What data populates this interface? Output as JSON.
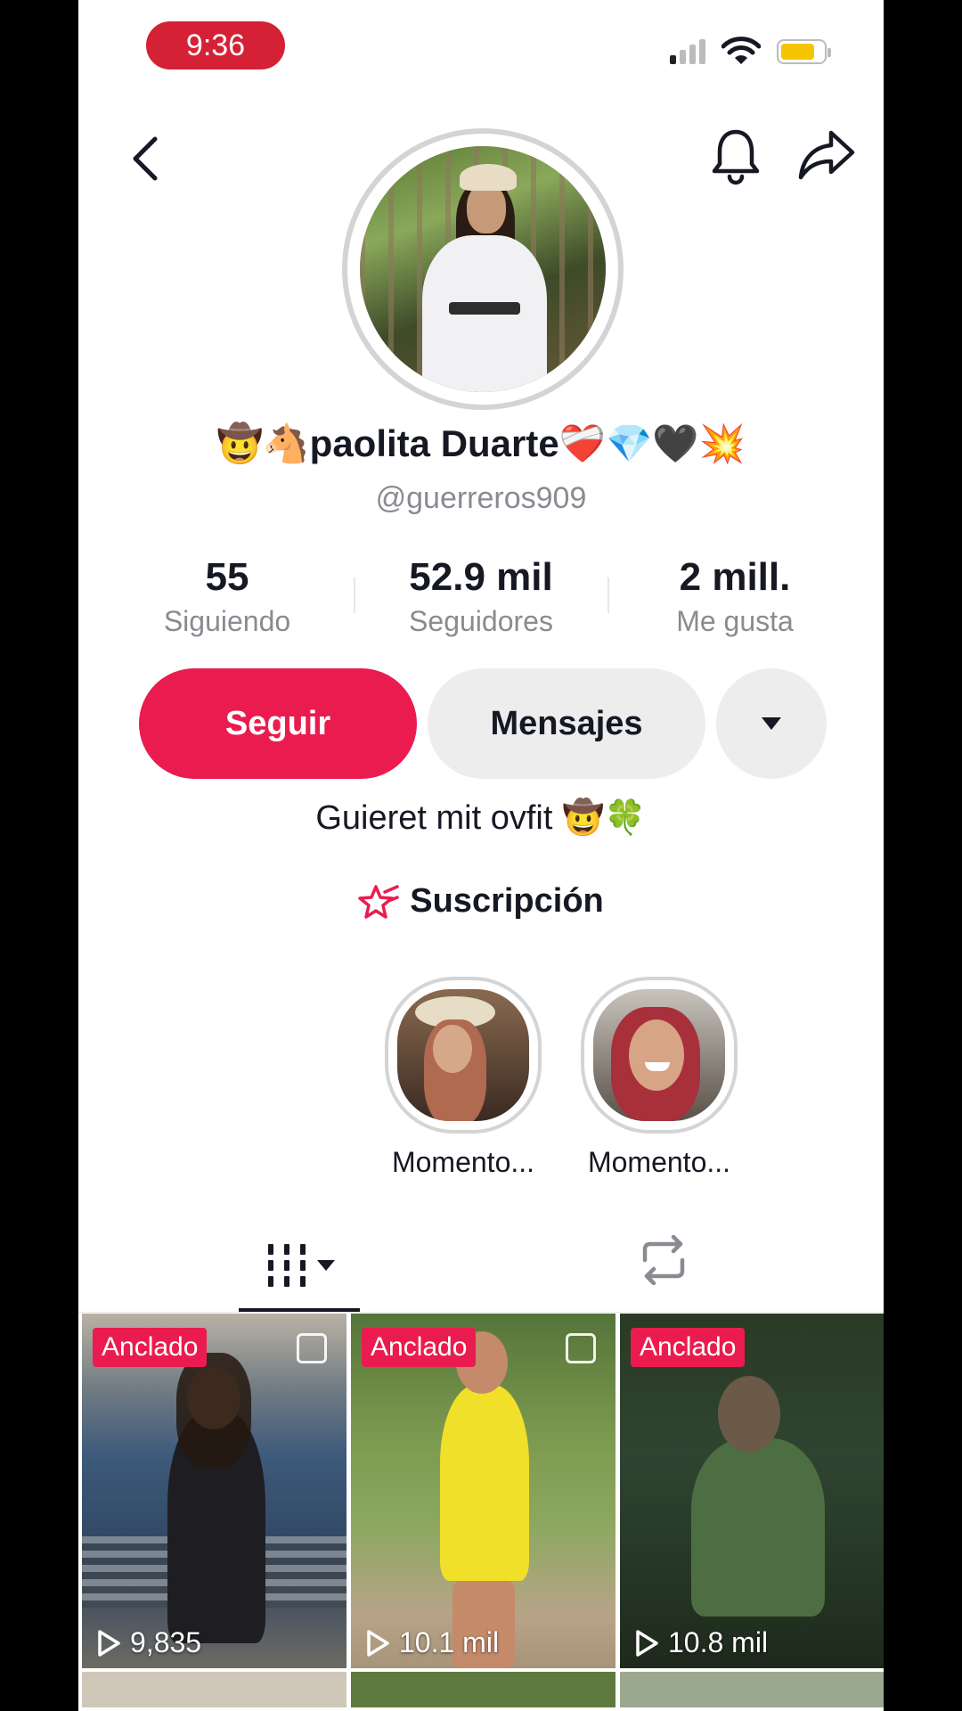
{
  "status_bar": {
    "time": "9:36"
  },
  "profile": {
    "display_name": "🤠🐴paolita Duarte❤️‍🩹💎🖤💥",
    "handle": "@guerreros909",
    "bio": "Guieret mit ovfit 🤠🍀",
    "subscription_label": "Suscripción"
  },
  "stats": [
    {
      "value": "55",
      "label": "Siguiendo"
    },
    {
      "value": "52.9 mil",
      "label": "Seguidores"
    },
    {
      "value": "2 mill.",
      "label": "Me gusta"
    }
  ],
  "actions": {
    "follow_label": "Seguir",
    "message_label": "Mensajes"
  },
  "highlights": [
    {
      "label": "Momento..."
    },
    {
      "label": "Momento..."
    }
  ],
  "videos": [
    {
      "badge": "Anclado",
      "views": "9,835"
    },
    {
      "badge": "Anclado",
      "views": "10.1 mil"
    },
    {
      "badge": "Anclado",
      "views": "10.8 mil"
    }
  ],
  "colors": {
    "accent": "#ea1c4f",
    "time_pill": "#d42135",
    "muted_text": "#8a8b91",
    "button_gray": "#ededed"
  },
  "icons": [
    "back-icon",
    "bell-icon",
    "share-icon",
    "chevron-down-icon",
    "subscription-star-icon",
    "grid-icon",
    "repost-icon",
    "play-icon"
  ]
}
